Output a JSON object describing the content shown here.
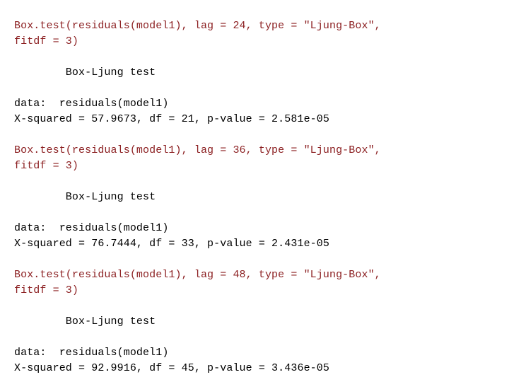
{
  "console": {
    "background_color": "#ffffff",
    "command_color": "#8c2022",
    "output_color": "#000000",
    "blocks": [
      {
        "command_lines": [
          "Box.test(residuals(model1), lag = 24, type = \"Ljung-Box\",",
          "fitdf = 3)"
        ],
        "spacer_before_heading": "",
        "heading": "        Box-Ljung test",
        "spacer_after_heading": "",
        "output_lines": [
          "data:  residuals(model1)",
          "X-squared = 57.9673, df = 21, p-value = 2.581e-05"
        ],
        "test_name": "Box-Ljung test",
        "data_label": "data:",
        "data_value": "residuals(model1)",
        "lag": "24",
        "type": "Ljung-Box",
        "fitdf": "3",
        "x_squared": "57.9673",
        "df": "21",
        "p_value": "2.581e-05"
      },
      {
        "command_lines": [
          "Box.test(residuals(model1), lag = 36, type = \"Ljung-Box\",",
          "fitdf = 3)"
        ],
        "spacer_before_heading": "",
        "heading": "        Box-Ljung test",
        "spacer_after_heading": "",
        "output_lines": [
          "data:  residuals(model1)",
          "X-squared = 76.7444, df = 33, p-value = 2.431e-05"
        ],
        "test_name": "Box-Ljung test",
        "data_label": "data:",
        "data_value": "residuals(model1)",
        "lag": "36",
        "type": "Ljung-Box",
        "fitdf": "3",
        "x_squared": "76.7444",
        "df": "33",
        "p_value": "2.431e-05"
      },
      {
        "command_lines": [
          "Box.test(residuals(model1), lag = 48, type = \"Ljung-Box\",",
          "fitdf = 3)"
        ],
        "spacer_before_heading": "",
        "heading": "        Box-Ljung test",
        "spacer_after_heading": "",
        "output_lines": [
          "data:  residuals(model1)",
          "X-squared = 92.9916, df = 45, p-value = 3.436e-05"
        ],
        "test_name": "Box-Ljung test",
        "data_label": "data:",
        "data_value": "residuals(model1)",
        "lag": "48",
        "type": "Ljung-Box",
        "fitdf": "3",
        "x_squared": "92.9916",
        "df": "45",
        "p_value": "3.436e-05"
      }
    ]
  }
}
